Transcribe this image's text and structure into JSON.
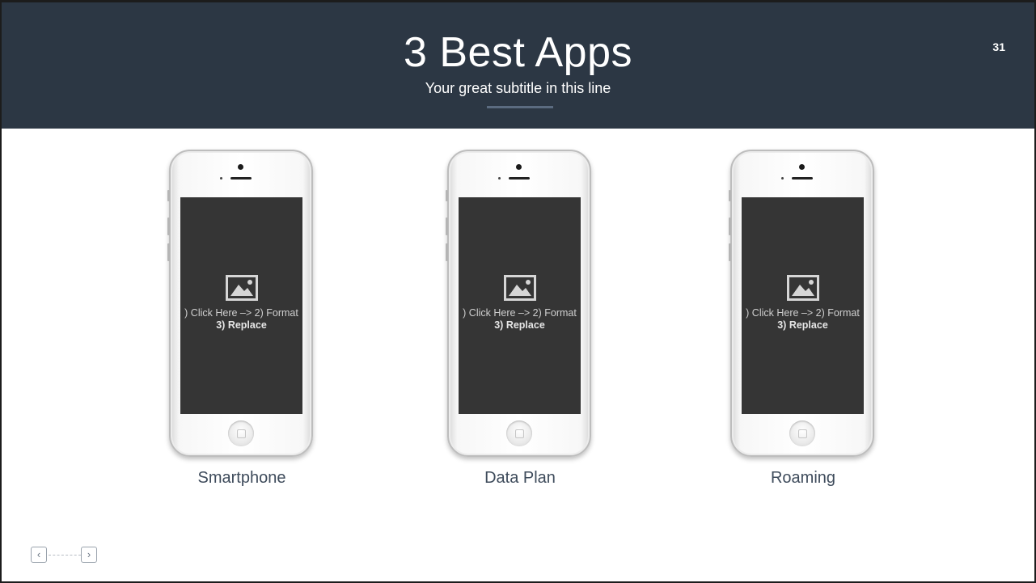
{
  "slide": {
    "title": "3 Best Apps",
    "subtitle": "Your great subtitle in this line",
    "page_number": "31"
  },
  "cards": [
    {
      "label": "Smartphone",
      "placeholder_line1": ") Click Here –> 2) Format",
      "placeholder_line2": "3) Replace"
    },
    {
      "label": "Data Plan",
      "placeholder_line1": ") Click Here –> 2) Format",
      "placeholder_line2": "3) Replace"
    },
    {
      "label": "Roaming",
      "placeholder_line1": ") Click Here –> 2) Format",
      "placeholder_line2": "3) Replace"
    }
  ],
  "navigation": {
    "prev_icon": "chevron-left-icon",
    "next_icon": "chevron-right-icon",
    "prev_glyph": "‹",
    "next_glyph": "›"
  },
  "colors": {
    "header_bg": "#2c3744",
    "accent_line": "#5b6b80",
    "label_text": "#3e4b5b",
    "screen_bg": "#353535"
  }
}
